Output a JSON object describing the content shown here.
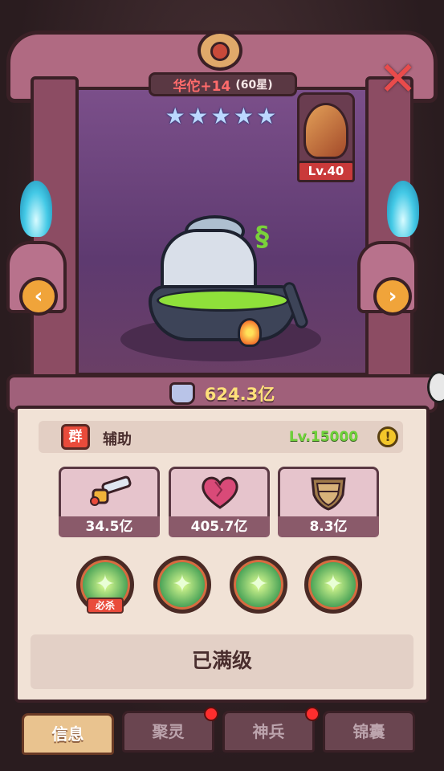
{
  "hero": {
    "name": "华佗+14",
    "star_text": "(60星)",
    "stars": [
      "★",
      "★",
      "★",
      "★",
      "★"
    ],
    "role": "辅助",
    "faction_badge": "群",
    "level": "Lv.15000",
    "power": "624.3亿"
  },
  "weapon": {
    "level": "Lv.40"
  },
  "stats": {
    "attack": "34.5亿",
    "hp": "405.7亿",
    "defense": "8.3亿"
  },
  "skills": {
    "skill_1_tag": "必杀",
    "icons": [
      "✦",
      "✦",
      "✦",
      "✦"
    ]
  },
  "actions": {
    "max_level": "已满级",
    "close": "✕",
    "prev": "‹",
    "next": "›",
    "info": "!"
  },
  "tabs": [
    {
      "label": "信息"
    },
    {
      "label": "聚灵"
    },
    {
      "label": "神兵"
    },
    {
      "label": "锦囊"
    }
  ],
  "icons": {
    "steam": "§"
  }
}
